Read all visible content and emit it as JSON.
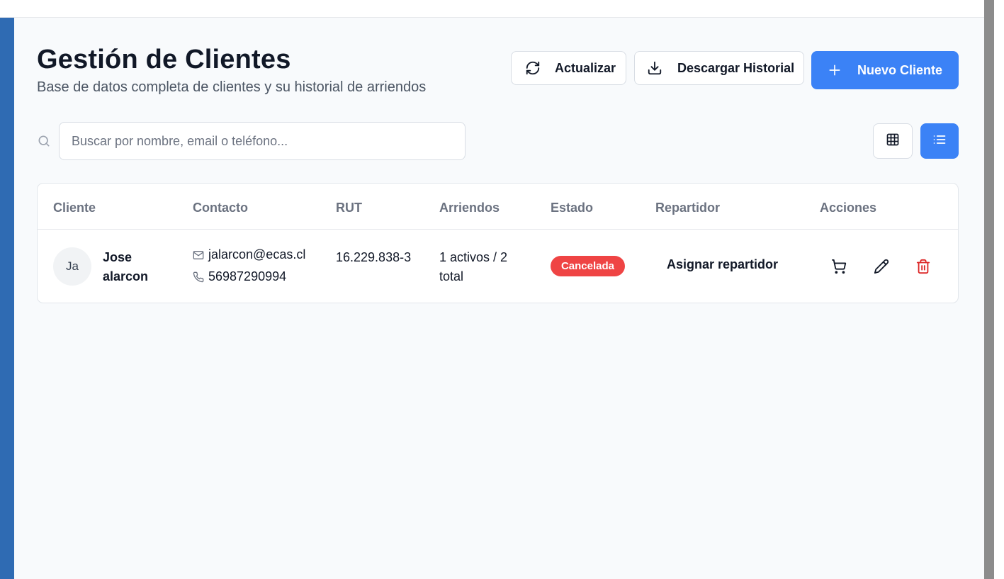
{
  "header": {
    "title": "Gestión de Clientes",
    "subtitle": "Base de datos completa de clientes y su historial de arriendos"
  },
  "toolbar": {
    "refresh_label": "Actualizar",
    "download_label": "Descargar Historial",
    "new_client_label": "Nuevo Cliente"
  },
  "search": {
    "placeholder": "Buscar por nombre, email o teléfono...",
    "value": ""
  },
  "view_toggle": {
    "active": "list",
    "options": [
      "grid",
      "list"
    ]
  },
  "table": {
    "columns": [
      "Cliente",
      "Contacto",
      "RUT",
      "Arriendos",
      "Estado",
      "Repartidor",
      "Acciones"
    ],
    "rows": [
      {
        "initials": "Ja",
        "name": "Jose alarcon",
        "email": "jalarcon@ecas.cl",
        "phone": "56987290994",
        "rut": "16.229.838-3",
        "rentals": "1 activos / 2 total",
        "status": "Cancelada",
        "courier_action": "Asignar repartidor",
        "actions": [
          "cart-icon",
          "edit-icon",
          "delete-icon"
        ]
      }
    ]
  },
  "colors": {
    "primary": "#3b82f6",
    "sidebar": "#2f6bb3",
    "status_cancelled": "#ef4444",
    "delete": "#dc2626"
  }
}
